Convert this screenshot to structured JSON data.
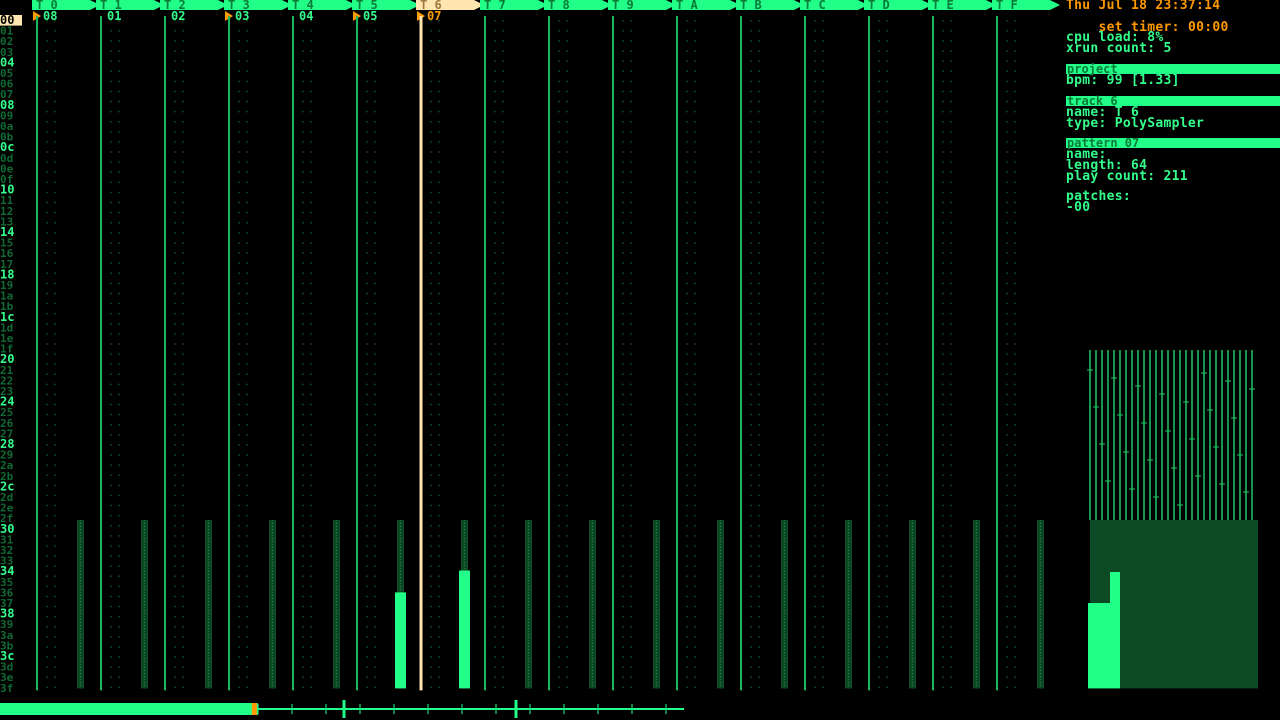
{
  "datetime": "Thu Jul 18 23:37:14",
  "timer": {
    "label": "set timer:",
    "value": "00:00"
  },
  "system": {
    "cpu_load": "cpu load: 8%",
    "xrun_count": "xrun count: 5"
  },
  "project": {
    "header": "project",
    "bpm": "bpm: 99 [1.33]"
  },
  "track": {
    "header": "track 6",
    "name": "name: T 6",
    "type": "type: PolySampler"
  },
  "pattern": {
    "header": "pattern 07",
    "name": "name:",
    "length": "length: 64",
    "play_count": "play count: 211"
  },
  "patches": {
    "label": "patches:",
    "value": "-00"
  },
  "tracks": [
    {
      "label": "T 0",
      "pattern": "08",
      "playing": true,
      "level": 0
    },
    {
      "label": "T 1",
      "pattern": "01",
      "playing": false,
      "level": 0
    },
    {
      "label": "T 2",
      "pattern": "02",
      "playing": false,
      "level": 0
    },
    {
      "label": "T 3",
      "pattern": "03",
      "playing": true,
      "level": 0
    },
    {
      "label": "T 4",
      "pattern": "04",
      "playing": false,
      "level": 0
    },
    {
      "label": "T 5",
      "pattern": "05",
      "playing": true,
      "level": 0.57
    },
    {
      "label": "T 6",
      "pattern": "07",
      "playing": true,
      "level": 0.7,
      "selected": true
    },
    {
      "label": "T 7",
      "pattern": "",
      "playing": false,
      "level": 0
    },
    {
      "label": "T 8",
      "pattern": "",
      "playing": false,
      "level": 0
    },
    {
      "label": "T 9",
      "pattern": "",
      "playing": false,
      "level": 0
    },
    {
      "label": "T A",
      "pattern": "",
      "playing": false,
      "level": 0
    },
    {
      "label": "T B",
      "pattern": "",
      "playing": false,
      "level": 0
    },
    {
      "label": "T C",
      "pattern": "",
      "playing": false,
      "level": 0
    },
    {
      "label": "T D",
      "pattern": "",
      "playing": false,
      "level": 0
    },
    {
      "label": "T E",
      "pattern": "",
      "playing": false,
      "level": 0
    },
    {
      "label": "T F",
      "pattern": "",
      "playing": false,
      "level": 0
    }
  ],
  "rows": [
    "00",
    "01",
    "02",
    "03",
    "04",
    "05",
    "06",
    "07",
    "08",
    "09",
    "0a",
    "0b",
    "0c",
    "0d",
    "0e",
    "0f",
    "10",
    "11",
    "12",
    "13",
    "14",
    "15",
    "16",
    "17",
    "18",
    "19",
    "1a",
    "1b",
    "1c",
    "1d",
    "1e",
    "1f",
    "20",
    "21",
    "22",
    "23",
    "24",
    "25",
    "26",
    "27",
    "28",
    "29",
    "2a",
    "2b",
    "2c",
    "2d",
    "2e",
    "2f",
    "30",
    "31",
    "32",
    "33",
    "34",
    "35",
    "36",
    "37",
    "38",
    "39",
    "3a",
    "3b",
    "3c",
    "3d",
    "3e",
    "3f"
  ],
  "current_row": "00",
  "song_progress": 0.26,
  "colors": {
    "green": "#33ff8c",
    "bright_green": "#22ff88",
    "dim_green": "#0f6a34",
    "orange": "#ff9900",
    "cursor": "#ffe6b0"
  }
}
